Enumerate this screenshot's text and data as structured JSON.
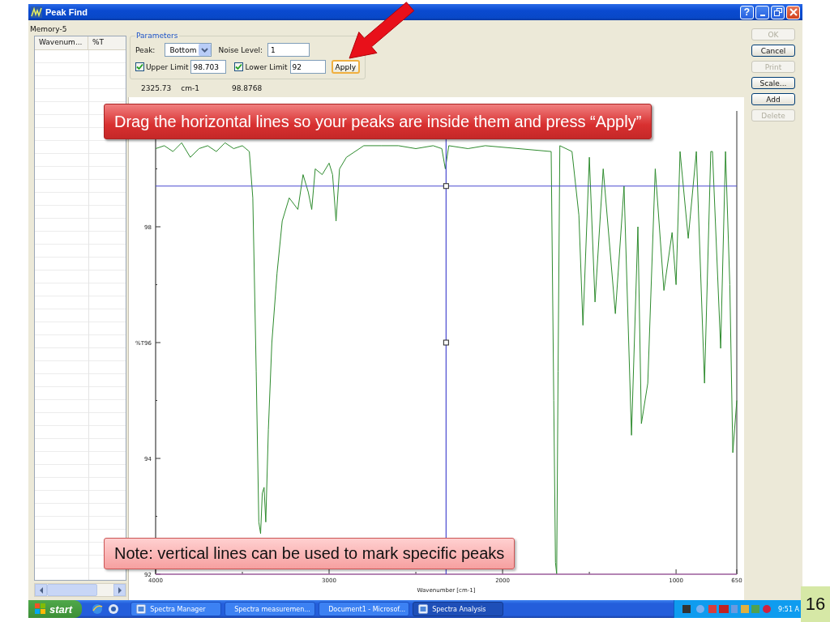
{
  "window": {
    "title": "Peak Find",
    "help_button": "?"
  },
  "memory_label": "Memory-5",
  "peak_table": {
    "columns": [
      "Wavenum...",
      "%T"
    ]
  },
  "parameters": {
    "legend": "Parameters",
    "peak_label": "Peak:",
    "peak_value": "Bottom",
    "noise_label": "Noise Level:",
    "noise_value": "1",
    "limits": [
      {
        "label": "Upper Limit",
        "checked": true,
        "value": "98.703"
      },
      {
        "label": "Lower Limit",
        "checked": true,
        "value": "92"
      }
    ],
    "apply": "Apply"
  },
  "cursor_readout": {
    "wavenumber": "2325.73",
    "unit": "cm-1",
    "value": "98.8768"
  },
  "buttons": [
    {
      "label": "OK",
      "disabled": true
    },
    {
      "label": "Cancel",
      "disabled": false
    },
    {
      "label": "Print",
      "disabled": true
    },
    {
      "label": "Scale...",
      "disabled": false
    },
    {
      "label": "Add",
      "disabled": false
    },
    {
      "label": "Delete",
      "disabled": true
    }
  ],
  "chart": {
    "chart_data": {
      "type": "line",
      "xlabel": "Wavenumber [cm-1]",
      "ylabel": "%T",
      "xlim": [
        4000,
        650
      ],
      "ylim": [
        92,
        100
      ],
      "xticks": [
        4000,
        3000,
        2000,
        1000,
        650
      ],
      "yticks": [
        92,
        94,
        96,
        98
      ],
      "x": [
        4000,
        3950,
        3900,
        3850,
        3800,
        3750,
        3700,
        3650,
        3600,
        3550,
        3500,
        3460,
        3440,
        3420,
        3405,
        3395,
        3385,
        3375,
        3365,
        3350,
        3330,
        3300,
        3270,
        3230,
        3180,
        3150,
        3120,
        3100,
        3080,
        3040,
        3000,
        2980,
        2960,
        2940,
        2900,
        2800,
        2700,
        2600,
        2500,
        2400,
        2350,
        2330,
        2310,
        2200,
        2100,
        1720,
        1705,
        1695,
        1688,
        1680,
        1670,
        1600,
        1560,
        1537,
        1500,
        1467,
        1420,
        1350,
        1300,
        1257,
        1220,
        1200,
        1163,
        1120,
        1070,
        1023,
        1000,
        977,
        930,
        883,
        836,
        800,
        790,
        743,
        715,
        690,
        673,
        650
      ],
      "series": [
        {
          "color": "#2e8b2e",
          "values": [
            99.35,
            99.4,
            99.3,
            99.45,
            99.2,
            99.35,
            99.4,
            99.3,
            99.45,
            99.35,
            99.4,
            99.3,
            98.5,
            95.5,
            92.9,
            92.7,
            93.4,
            93.5,
            92.9,
            94.5,
            96.0,
            97.2,
            98.1,
            98.5,
            98.3,
            98.9,
            98.6,
            98.3,
            99.0,
            98.9,
            99.1,
            98.9,
            98.1,
            99.0,
            99.2,
            99.4,
            99.4,
            99.4,
            99.35,
            99.4,
            99.35,
            99.0,
            99.4,
            99.35,
            99.4,
            99.3,
            95.0,
            92.2,
            92.0,
            95.5,
            99.4,
            99.3,
            98.2,
            96.3,
            99.2,
            96.7,
            99.0,
            96.5,
            98.7,
            94.4,
            98.0,
            94.6,
            95.3,
            99.0,
            96.9,
            97.9,
            97.0,
            99.3,
            97.8,
            99.3,
            95.3,
            99.3,
            99.3,
            95.9,
            99.3,
            97.0,
            94.1,
            95.0
          ]
        }
      ]
    }
  },
  "callouts": [
    {
      "kind": "instruction",
      "text": "Drag the horizontal lines so your peaks are inside them and press “Apply”"
    },
    {
      "kind": "note",
      "text": "Note: vertical lines can be used to mark specific peaks"
    }
  ],
  "taskbar": {
    "start": "start",
    "tasks": [
      {
        "label": "Spectra Manager",
        "selected": false
      },
      {
        "label": "Spectra measuremen...",
        "selected": false
      },
      {
        "label": "Document1 - Microsof...",
        "selected": false
      },
      {
        "label": "Spectra Analysis",
        "selected": true
      }
    ],
    "clock": "9:51 A"
  },
  "slide_number": "16"
}
